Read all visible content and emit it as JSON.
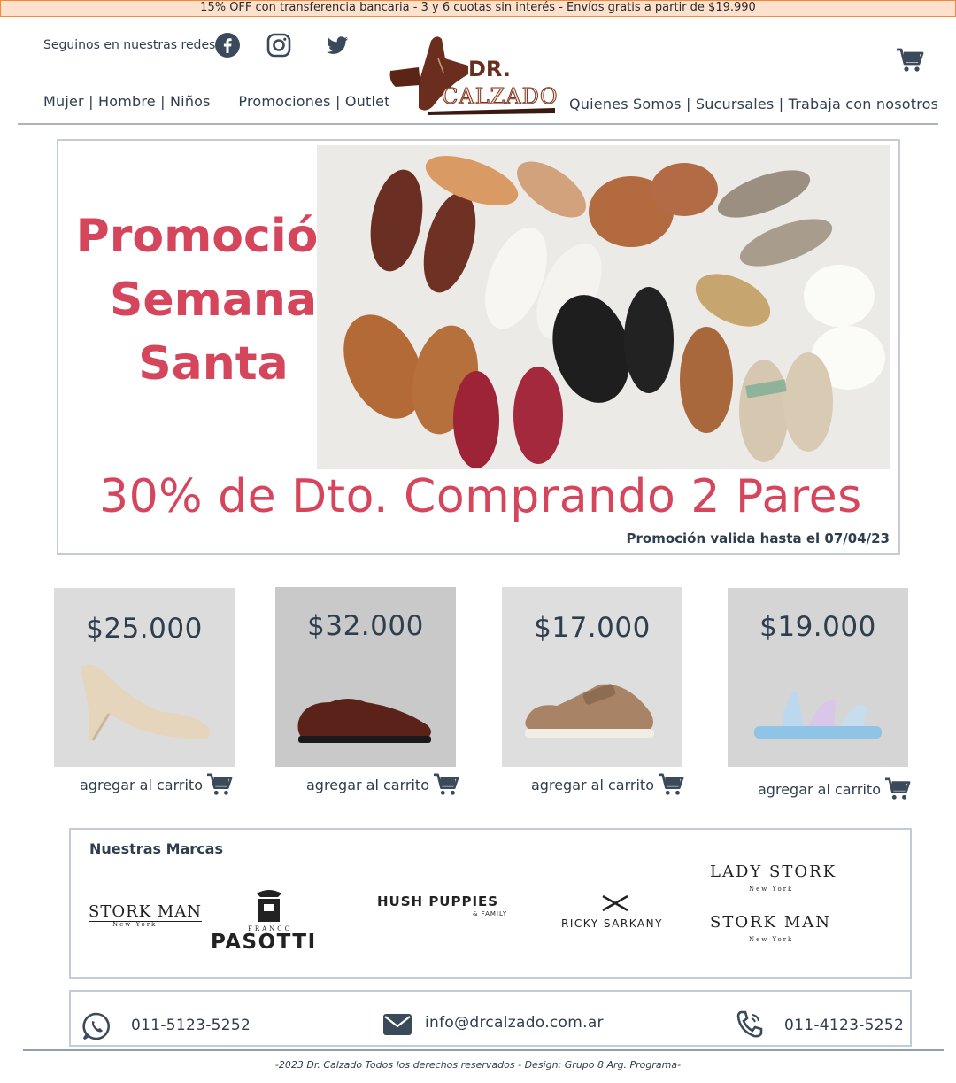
{
  "topbar": {
    "text": "15% OFF con transferencia bancaria - 3 y 6 cuotas sin interés - Envíos gratis a partir de $19.990"
  },
  "header": {
    "social_label": "Seguinos en nuestras redes",
    "social_icons": [
      "facebook-icon",
      "instagram-icon",
      "twitter-icon"
    ],
    "logo_text_top": "DR.",
    "logo_text_bottom": "CALZADO",
    "nav_left": [
      "Mujer",
      "Hombre",
      "Niños",
      "Promociones",
      "Outlet"
    ],
    "nav_right": [
      "Quienes Somos",
      "Sucursales",
      "Trabaja con nosotros"
    ]
  },
  "promo": {
    "title_lines": [
      "Promoción",
      "Semana",
      "Santa"
    ],
    "subtitle": "30% de Dto. Comprando 2 Pares",
    "valid": "Promoción valida hasta el 07/04/23"
  },
  "products": [
    {
      "price": "$25.000",
      "add_label": "agregar al carrito"
    },
    {
      "price": "$32.000",
      "add_label": "agregar al carrito"
    },
    {
      "price": "$17.000",
      "add_label": "agregar al carrito"
    },
    {
      "price": "$19.000",
      "add_label": "agregar al carrito"
    }
  ],
  "brands": {
    "title": "Nuestras Marcas",
    "items": {
      "stork_man": "STORK MAN",
      "stork_man_sub": "New York",
      "franco": "FRANCO",
      "pasotti": "PASOTTI",
      "hush": "HUSH PUPPIES",
      "hush_sub": "& FAMILY",
      "ricky": "RICKY SARKANY",
      "lady_stork": "LADY STORK",
      "lady_stork_sub": "New York",
      "stork_man2": "STORK MAN",
      "stork_man2_sub": "New York"
    }
  },
  "contact": {
    "whatsapp": "011-5123-5252",
    "email": "info@drcalzado.com.ar",
    "phone": "011-4123-5252"
  },
  "footer": {
    "text": "-2023 Dr. Calzado Todos los derechos reservados  - Design: Grupo 8 Arg. Programa-"
  },
  "colors": {
    "accent": "#d5465c",
    "text": "#2f3e4e",
    "topbar_bg": "#fde1cd",
    "topbar_border": "#f08a3a",
    "logo_brown": "#6b2e1e"
  }
}
